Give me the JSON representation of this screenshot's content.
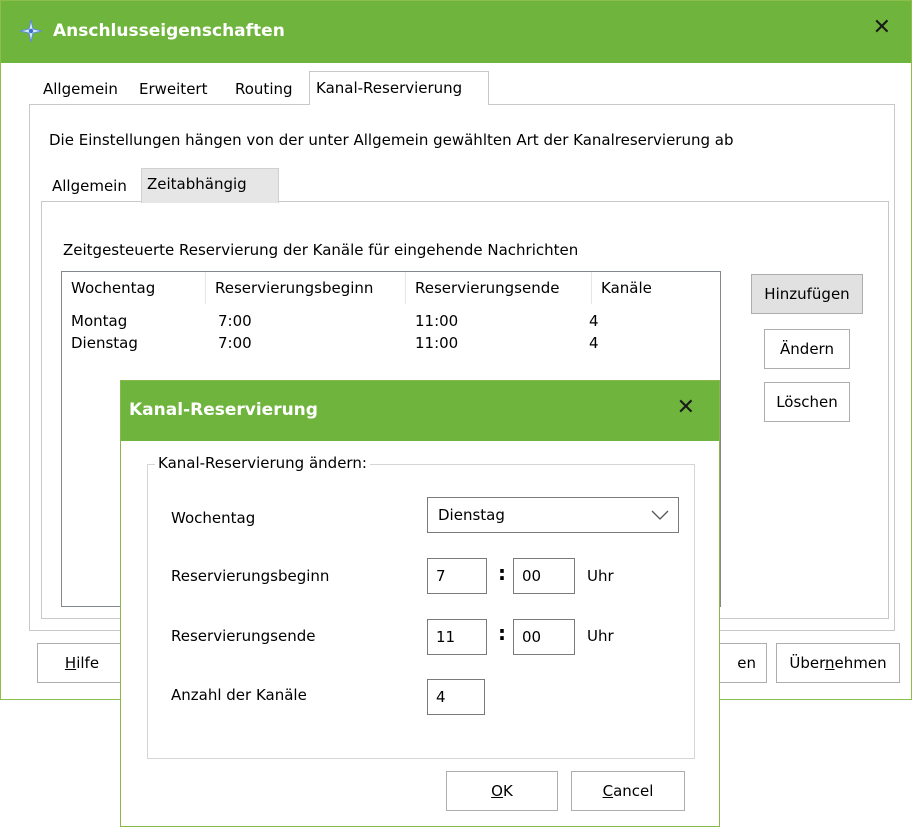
{
  "window": {
    "title": "Anschlusseigenschaften",
    "accent_color": "#6fb43c",
    "app_icon": "compass-star-icon",
    "close_glyph": "✕"
  },
  "tabs": [
    "Allgemein",
    "Erweitert",
    "Routing",
    "Kanal-Reservierung"
  ],
  "active_tab": "Kanal-Reservierung",
  "description": "Die Einstellungen hängen von der unter Allgemein gewählten Art der Kanalreservierung ab",
  "subtabs": [
    "Allgemein",
    "Zeitabhängig"
  ],
  "active_subtab": "Zeitabhängig",
  "list": {
    "caption": "Zeitgesteuerte Reservierung der Kanäle für eingehende Nachrichten",
    "columns": [
      "Wochentag",
      "Reservierungsbeginn",
      "Reservierungsende",
      "Kanäle"
    ],
    "rows": [
      [
        "Montag",
        "7:00",
        "11:00",
        "4"
      ],
      [
        "Dienstag",
        "7:00",
        "11:00",
        "4"
      ]
    ]
  },
  "side_buttons": {
    "add": "Hinzufügen",
    "edit": "Ändern",
    "delete": "Löschen"
  },
  "bottom_buttons": {
    "help_pre": "",
    "help_ul": "H",
    "help_post": "ilfe",
    "hidden_partial": "en",
    "apply_pre": "Über",
    "apply_ul": "n",
    "apply_post": "ehmen"
  },
  "dialog": {
    "title": "Kanal-Reservierung",
    "close_glyph": "✕",
    "group_label": "Kanal-Reservierung ändern:",
    "weekday_label": "Wochentag",
    "weekday_value": "Dienstag",
    "start_label": "Reservierungsbeginn",
    "start_hour": "7",
    "start_minute": "00",
    "end_label": "Reservierungsende",
    "end_hour": "11",
    "end_minute": "00",
    "unit": "Uhr",
    "colon": ":",
    "channels_label": "Anzahl der Kanäle",
    "channels_value": "4",
    "ok_ul": "O",
    "ok_post": "K",
    "cancel_ul": "C",
    "cancel_post": "ancel"
  }
}
